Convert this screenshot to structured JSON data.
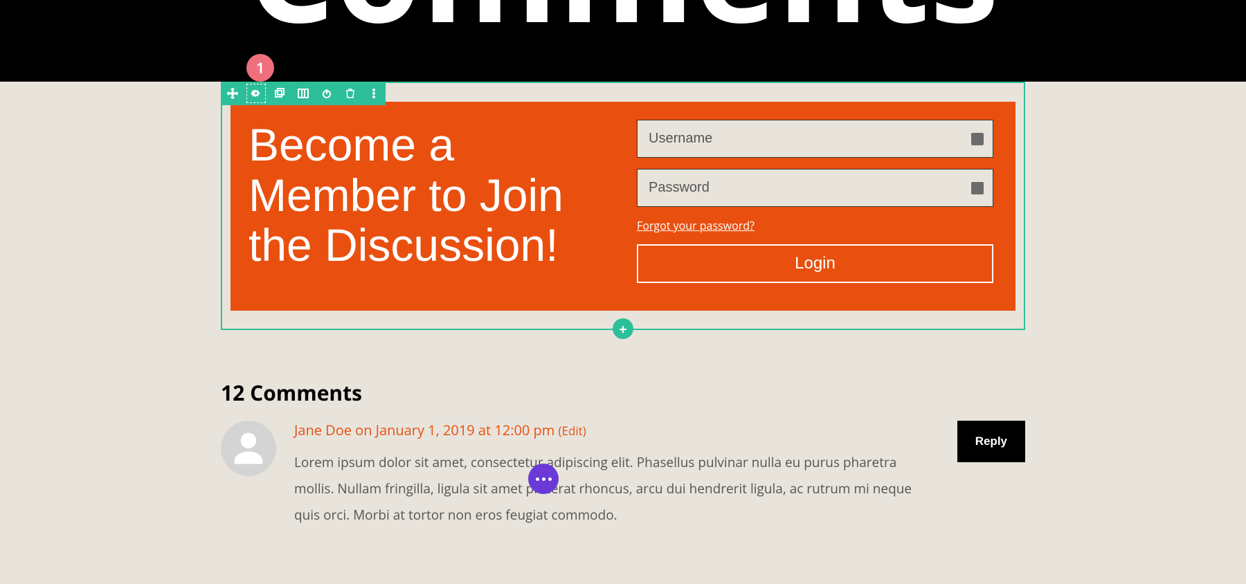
{
  "hero": {
    "title": "Comments"
  },
  "marker": {
    "number": "1"
  },
  "cta": {
    "heading": "Become a Member to Join the Discussion!",
    "username_placeholder": "Username",
    "password_placeholder": "Password",
    "forgot_link": "Forgot your password?",
    "login_label": "Login"
  },
  "comments": {
    "count_label": "12 Comments",
    "items": [
      {
        "author": "Jane Doe",
        "timestamp": "on January 1, 2019 at 12:00 pm",
        "edit_label": "Edit",
        "body": "Lorem ipsum dolor sit amet, consectetur adipiscing elit. Phasellus pulvinar nulla eu purus pharetra mollis. Nullam fringilla, ligula sit amet placerat rhoncus, arcu dui hendrerit ligula, ac rutrum mi neque quis orci. Morbi at tortor non eros feugiat commodo.",
        "reply_label": "Reply"
      }
    ]
  },
  "colors": {
    "accent": "#e94f0e",
    "builder": "#2dbf99",
    "marker": "#ef6f7c",
    "fab": "#6b39d6"
  }
}
